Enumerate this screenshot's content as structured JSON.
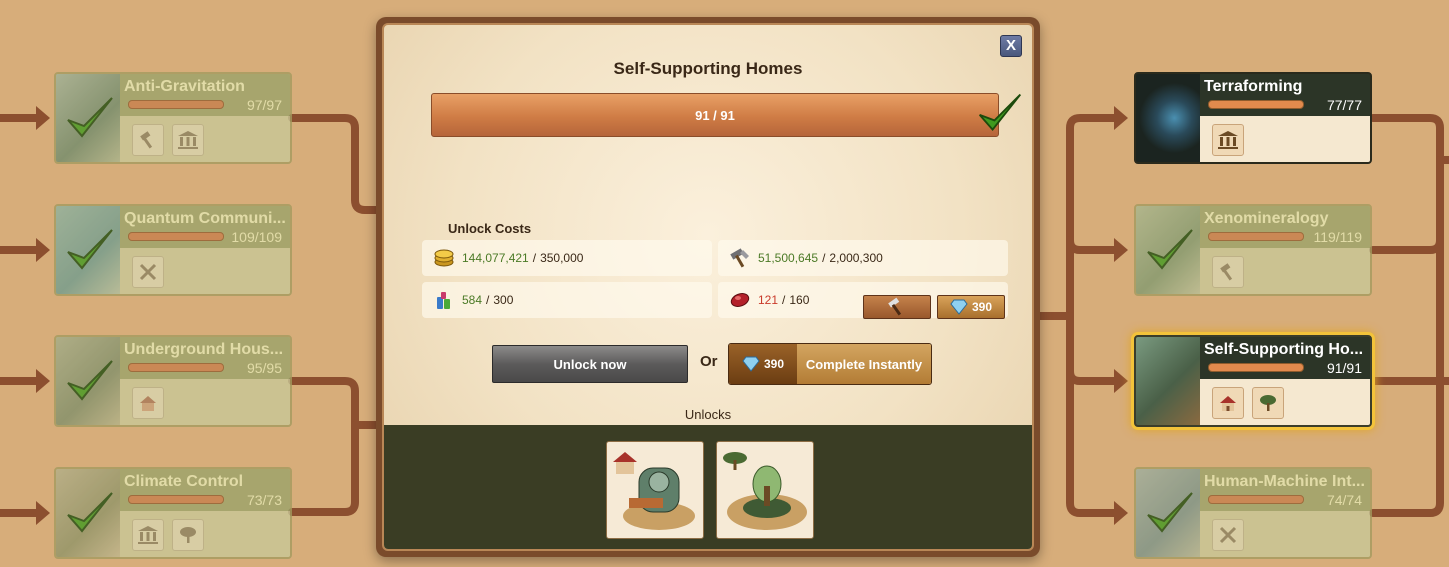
{
  "tree": {
    "left_nodes": [
      {
        "name": "Anti-Gravitation",
        "points": "97/97",
        "progress": 1.0,
        "icons": [
          "hammer-icon",
          "building-icon"
        ]
      },
      {
        "name": "Quantum Communi...",
        "points": "109/109",
        "progress": 1.0,
        "icons": [
          "swords-icon"
        ]
      },
      {
        "name": "Underground Hous...",
        "points": "95/95",
        "progress": 1.0,
        "icons": [
          "house-icon"
        ]
      },
      {
        "name": "Climate Control",
        "points": "73/73",
        "progress": 1.0,
        "icons": [
          "building-icon",
          "tree-icon"
        ]
      }
    ],
    "right_nodes": [
      {
        "name": "Terraforming",
        "points": "77/77",
        "progress": 1.0,
        "icons": [
          "building-icon"
        ]
      },
      {
        "name": "Xenomineralogy",
        "points": "119/119",
        "progress": 1.0,
        "icons": [
          "hammer-icon"
        ]
      },
      {
        "name": "Self-Supporting Ho...",
        "points": "91/91",
        "progress": 1.0,
        "icons": [
          "house-icon",
          "tree-icon"
        ]
      },
      {
        "name": "Human-Machine Int...",
        "points": "74/74",
        "progress": 1.0,
        "icons": [
          "swords-icon"
        ]
      }
    ]
  },
  "modal": {
    "close_label": "X",
    "title": "Self-Supporting Homes",
    "progress_text": "91 / 91",
    "progress_fraction": 1.0,
    "unlock_costs_title": "Unlock Costs",
    "costs": [
      {
        "icon": "coins-icon",
        "have": "144,077,421",
        "need": "350,000"
      },
      {
        "icon": "supplies-icon",
        "have": "51,500,645",
        "need": "2,000,300"
      },
      {
        "icon": "goods-icon",
        "have": "584",
        "need": "300"
      },
      {
        "icon": "ruby-icon",
        "have": "121",
        "need": "160"
      }
    ],
    "pay_diamond_amount": "390",
    "unlock_now_label": "Unlock now",
    "or_label": "Or",
    "complete_cost": "390",
    "complete_label": "Complete Instantly",
    "unlocks_label": "Unlocks",
    "unlock_items": [
      "house-building-icon",
      "tree-building-icon"
    ]
  },
  "colors": {
    "background": "#d7ad7a",
    "connector": "#8c4f2f",
    "progress_bar": "#cf7c45",
    "check": "#3f9a1f",
    "selected_glow": "#f3c33a"
  }
}
